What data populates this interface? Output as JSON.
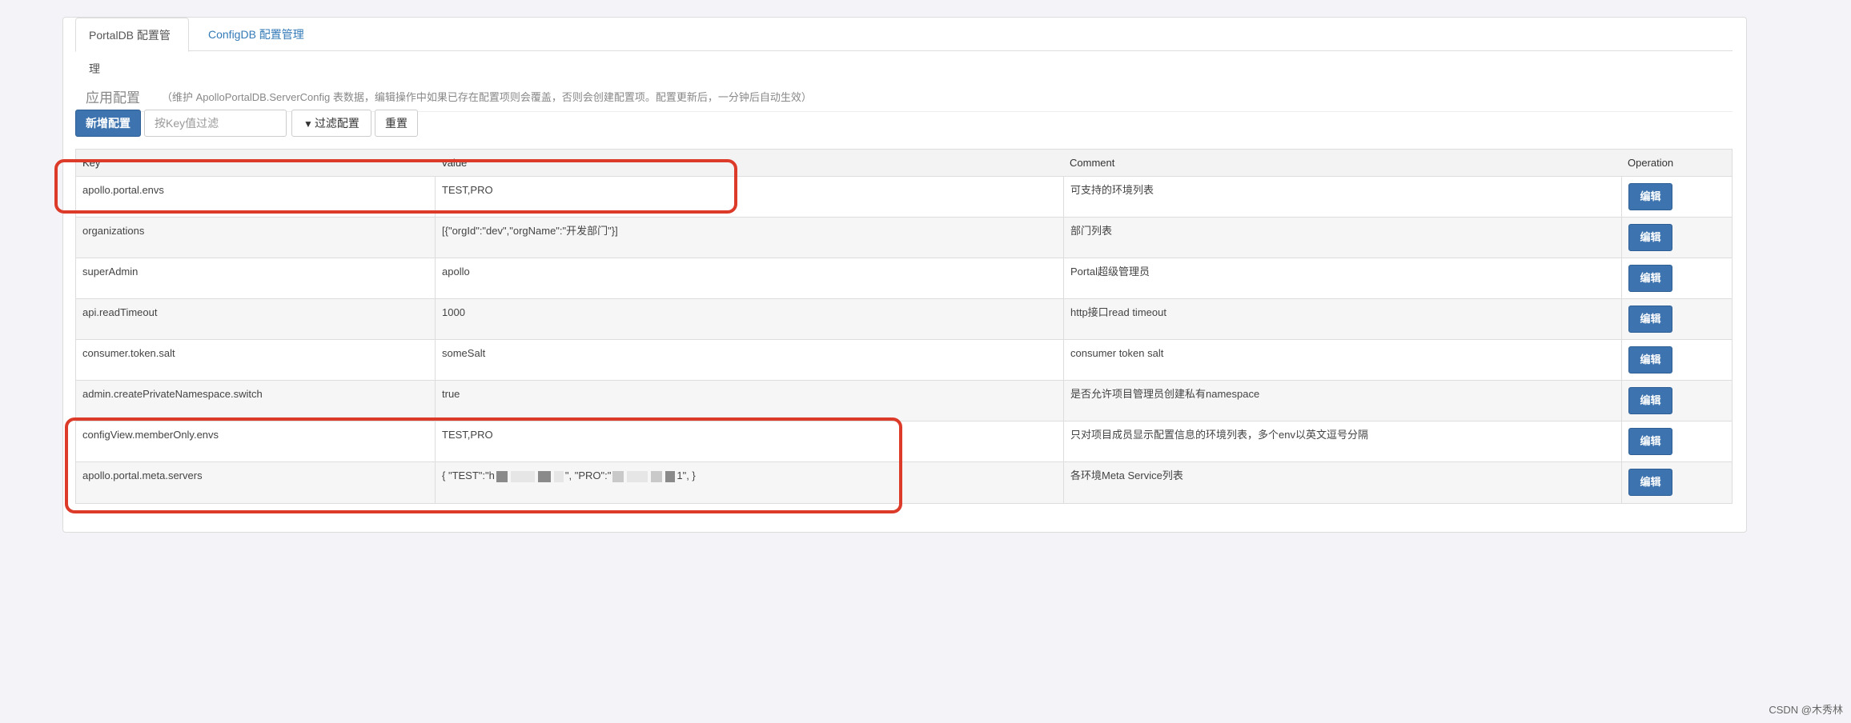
{
  "tabs": [
    {
      "label": "PortalDB 配置管理"
    },
    {
      "label": "ConfigDB 配置管理"
    }
  ],
  "section": {
    "title": "应用配置",
    "description": "（维护 ApolloPortalDB.ServerConfig 表数据，编辑操作中如果已存在配置项则会覆盖，否则会创建配置项。配置更新后，一分钟后自动生效）"
  },
  "toolbar": {
    "add_label": "新增配置",
    "filter_placeholder": "按Key值过滤",
    "filter_label": "过滤配置",
    "reset_label": "重置"
  },
  "table": {
    "headers": {
      "key": "Key",
      "value": "Value",
      "comment": "Comment",
      "operation": "Operation"
    },
    "edit_label": "编辑",
    "rows": [
      {
        "key": "apollo.portal.envs",
        "value": "TEST,PRO",
        "comment": "可支持的环境列表"
      },
      {
        "key": "organizations",
        "value": "[{\"orgId\":\"dev\",\"orgName\":\"开发部门\"}]",
        "comment": "部门列表"
      },
      {
        "key": "superAdmin",
        "value": "apollo",
        "comment": "Portal超级管理员"
      },
      {
        "key": "api.readTimeout",
        "value": "1000",
        "comment": "http接口read timeout"
      },
      {
        "key": "consumer.token.salt",
        "value": "someSalt",
        "comment": "consumer token salt"
      },
      {
        "key": "admin.createPrivateNamespace.switch",
        "value": "true",
        "comment": "是否允许项目管理员创建私有namespace"
      },
      {
        "key": "configView.memberOnly.envs",
        "value": "TEST,PRO",
        "comment": "只对项目成员显示配置信息的环境列表，多个env以英文逗号分隔"
      },
      {
        "key": "apollo.portal.meta.servers",
        "value_parts": [
          "{ \"TEST\":\"h",
          "\", \"PRO\":\"",
          "1\", }"
        ],
        "comment": "各环境Meta Service列表"
      }
    ]
  },
  "watermark": "CSDN @木秀林",
  "colors": {
    "primary": "#3d73ae",
    "highlight": "#dc3b2a",
    "link": "#337ab7"
  }
}
